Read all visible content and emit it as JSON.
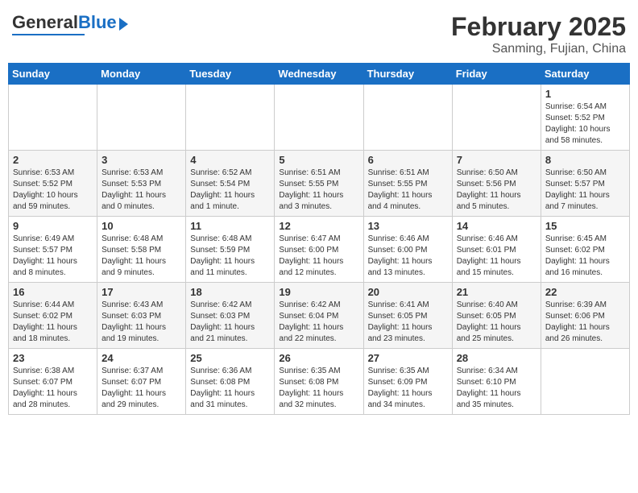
{
  "header": {
    "logo_general": "General",
    "logo_blue": "Blue",
    "month_title": "February 2025",
    "location": "Sanming, Fujian, China"
  },
  "weekdays": [
    "Sunday",
    "Monday",
    "Tuesday",
    "Wednesday",
    "Thursday",
    "Friday",
    "Saturday"
  ],
  "weeks": [
    [
      {
        "day": "",
        "info": ""
      },
      {
        "day": "",
        "info": ""
      },
      {
        "day": "",
        "info": ""
      },
      {
        "day": "",
        "info": ""
      },
      {
        "day": "",
        "info": ""
      },
      {
        "day": "",
        "info": ""
      },
      {
        "day": "1",
        "info": "Sunrise: 6:54 AM\nSunset: 5:52 PM\nDaylight: 10 hours\nand 58 minutes."
      }
    ],
    [
      {
        "day": "2",
        "info": "Sunrise: 6:53 AM\nSunset: 5:52 PM\nDaylight: 10 hours\nand 59 minutes."
      },
      {
        "day": "3",
        "info": "Sunrise: 6:53 AM\nSunset: 5:53 PM\nDaylight: 11 hours\nand 0 minutes."
      },
      {
        "day": "4",
        "info": "Sunrise: 6:52 AM\nSunset: 5:54 PM\nDaylight: 11 hours\nand 1 minute."
      },
      {
        "day": "5",
        "info": "Sunrise: 6:51 AM\nSunset: 5:55 PM\nDaylight: 11 hours\nand 3 minutes."
      },
      {
        "day": "6",
        "info": "Sunrise: 6:51 AM\nSunset: 5:55 PM\nDaylight: 11 hours\nand 4 minutes."
      },
      {
        "day": "7",
        "info": "Sunrise: 6:50 AM\nSunset: 5:56 PM\nDaylight: 11 hours\nand 5 minutes."
      },
      {
        "day": "8",
        "info": "Sunrise: 6:50 AM\nSunset: 5:57 PM\nDaylight: 11 hours\nand 7 minutes."
      }
    ],
    [
      {
        "day": "9",
        "info": "Sunrise: 6:49 AM\nSunset: 5:57 PM\nDaylight: 11 hours\nand 8 minutes."
      },
      {
        "day": "10",
        "info": "Sunrise: 6:48 AM\nSunset: 5:58 PM\nDaylight: 11 hours\nand 9 minutes."
      },
      {
        "day": "11",
        "info": "Sunrise: 6:48 AM\nSunset: 5:59 PM\nDaylight: 11 hours\nand 11 minutes."
      },
      {
        "day": "12",
        "info": "Sunrise: 6:47 AM\nSunset: 6:00 PM\nDaylight: 11 hours\nand 12 minutes."
      },
      {
        "day": "13",
        "info": "Sunrise: 6:46 AM\nSunset: 6:00 PM\nDaylight: 11 hours\nand 13 minutes."
      },
      {
        "day": "14",
        "info": "Sunrise: 6:46 AM\nSunset: 6:01 PM\nDaylight: 11 hours\nand 15 minutes."
      },
      {
        "day": "15",
        "info": "Sunrise: 6:45 AM\nSunset: 6:02 PM\nDaylight: 11 hours\nand 16 minutes."
      }
    ],
    [
      {
        "day": "16",
        "info": "Sunrise: 6:44 AM\nSunset: 6:02 PM\nDaylight: 11 hours\nand 18 minutes."
      },
      {
        "day": "17",
        "info": "Sunrise: 6:43 AM\nSunset: 6:03 PM\nDaylight: 11 hours\nand 19 minutes."
      },
      {
        "day": "18",
        "info": "Sunrise: 6:42 AM\nSunset: 6:03 PM\nDaylight: 11 hours\nand 21 minutes."
      },
      {
        "day": "19",
        "info": "Sunrise: 6:42 AM\nSunset: 6:04 PM\nDaylight: 11 hours\nand 22 minutes."
      },
      {
        "day": "20",
        "info": "Sunrise: 6:41 AM\nSunset: 6:05 PM\nDaylight: 11 hours\nand 23 minutes."
      },
      {
        "day": "21",
        "info": "Sunrise: 6:40 AM\nSunset: 6:05 PM\nDaylight: 11 hours\nand 25 minutes."
      },
      {
        "day": "22",
        "info": "Sunrise: 6:39 AM\nSunset: 6:06 PM\nDaylight: 11 hours\nand 26 minutes."
      }
    ],
    [
      {
        "day": "23",
        "info": "Sunrise: 6:38 AM\nSunset: 6:07 PM\nDaylight: 11 hours\nand 28 minutes."
      },
      {
        "day": "24",
        "info": "Sunrise: 6:37 AM\nSunset: 6:07 PM\nDaylight: 11 hours\nand 29 minutes."
      },
      {
        "day": "25",
        "info": "Sunrise: 6:36 AM\nSunset: 6:08 PM\nDaylight: 11 hours\nand 31 minutes."
      },
      {
        "day": "26",
        "info": "Sunrise: 6:35 AM\nSunset: 6:08 PM\nDaylight: 11 hours\nand 32 minutes."
      },
      {
        "day": "27",
        "info": "Sunrise: 6:35 AM\nSunset: 6:09 PM\nDaylight: 11 hours\nand 34 minutes."
      },
      {
        "day": "28",
        "info": "Sunrise: 6:34 AM\nSunset: 6:10 PM\nDaylight: 11 hours\nand 35 minutes."
      },
      {
        "day": "",
        "info": ""
      }
    ]
  ]
}
